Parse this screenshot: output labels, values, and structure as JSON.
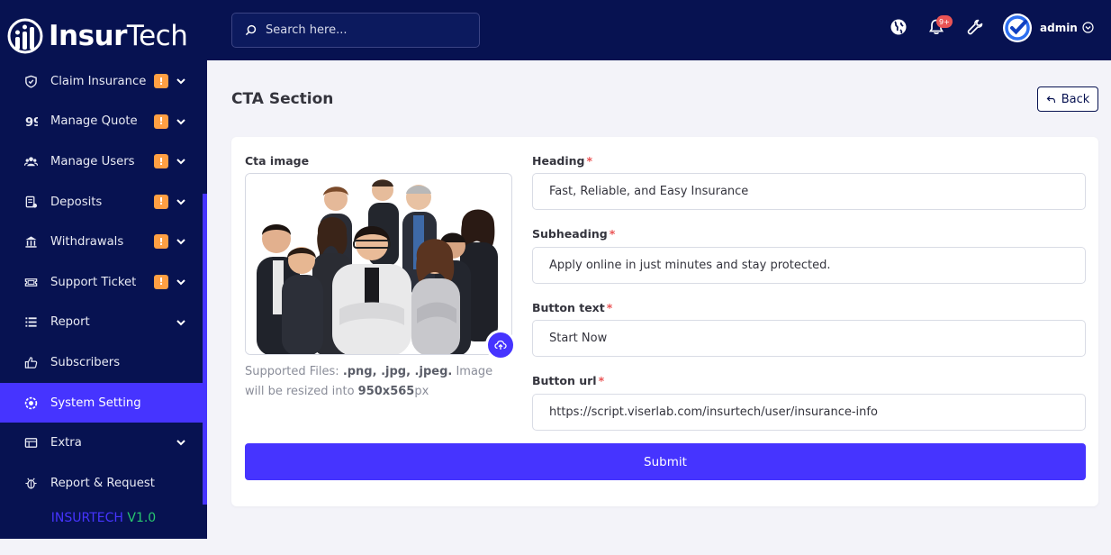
{
  "brand": {
    "name_part1": "Insur",
    "name_part2": "Tech"
  },
  "sidebar": {
    "items": [
      {
        "label": "Claim Insurance",
        "icon": "shield-icon",
        "badge": "!",
        "has_chevron": true
      },
      {
        "label": "Manage Quote",
        "icon": "quote-icon",
        "badge": "!",
        "has_chevron": true
      },
      {
        "label": "Manage Users",
        "icon": "users-icon",
        "badge": "!",
        "has_chevron": true
      },
      {
        "label": "Deposits",
        "icon": "deposit-icon",
        "badge": "!",
        "has_chevron": true
      },
      {
        "label": "Withdrawals",
        "icon": "bank-icon",
        "badge": "!",
        "has_chevron": true
      },
      {
        "label": "Support Ticket",
        "icon": "ticket-icon",
        "badge": "!",
        "has_chevron": true
      },
      {
        "label": "Report",
        "icon": "list-icon",
        "badge": "",
        "has_chevron": true
      },
      {
        "label": "Subscribers",
        "icon": "thumbs-up-icon",
        "badge": "",
        "has_chevron": false
      },
      {
        "label": "System Setting",
        "icon": "gear-icon",
        "badge": "",
        "has_chevron": false,
        "active": true
      },
      {
        "label": "Extra",
        "icon": "extra-icon",
        "badge": "",
        "has_chevron": true
      },
      {
        "label": "Report & Request",
        "icon": "bug-icon",
        "badge": "",
        "has_chevron": false
      }
    ],
    "version_name": "INSURTECH",
    "version_number": "V1.0"
  },
  "topbar": {
    "search_placeholder": "Search here...",
    "notification_count": "9+",
    "admin_name": "admin"
  },
  "main": {
    "title": "CTA Section",
    "back_label": "Back",
    "image_label": "Cta image",
    "help_prefix": "Supported Files: ",
    "help_formats": ".png, .jpg, .jpeg.",
    "help_mid": " Image will be resized into ",
    "help_size": "950x565",
    "help_suffix": "px",
    "fields": [
      {
        "label": "Heading",
        "value": "Fast, Reliable, and Easy Insurance"
      },
      {
        "label": "Subheading",
        "value": "Apply online in just minutes and stay protected."
      },
      {
        "label": "Button text",
        "value": "Start Now"
      },
      {
        "label": "Button url",
        "value": "https://script.viserlab.com/insurtech/user/insurance-info"
      }
    ],
    "required_mark": "*",
    "submit_label": "Submit"
  },
  "colors": {
    "sidebar_bg": "#071251",
    "accent": "#4634ff",
    "warning": "#ff9f43",
    "danger": "#ea5455",
    "success": "#28c76f"
  }
}
